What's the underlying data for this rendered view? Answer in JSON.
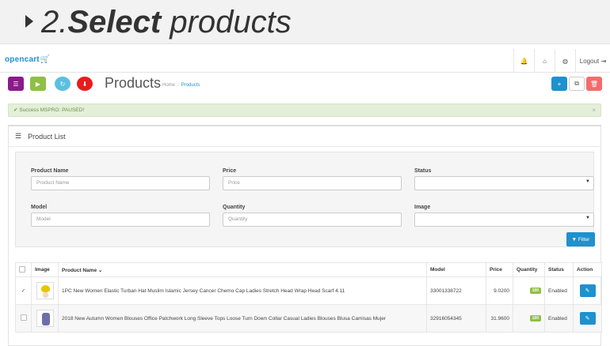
{
  "banner": {
    "step": "2.",
    "word_bold": "Select",
    "word_rest": " products"
  },
  "navbar": {
    "logo": "opencart",
    "icons": [
      "bell-icon",
      "home-icon",
      "globe-icon"
    ],
    "logout_label": "Logout"
  },
  "toolbar": {
    "page_title": "Products",
    "breadcrumb": [
      "Home",
      "Products"
    ],
    "left_buttons": [
      {
        "name": "mspro-menu-button",
        "color": "#8b1a8b"
      },
      {
        "name": "mspro-start-button",
        "color": "#8fbf45"
      },
      {
        "name": "mspro-refresh-button",
        "color": "#5bc0de"
      },
      {
        "name": "mspro-download-button",
        "color": "#e81c1c"
      }
    ],
    "right_buttons": [
      {
        "name": "add-button",
        "color": "#1e91cf"
      },
      {
        "name": "copy-button",
        "color": "#ffffff"
      },
      {
        "name": "delete-button",
        "color": "#f56b6b"
      }
    ]
  },
  "alert": {
    "text": "Success MSPRO: PAUSED!",
    "close": "×"
  },
  "panel": {
    "title": "Product List"
  },
  "filter": {
    "product_name": {
      "label": "Product Name",
      "placeholder": "Product Name"
    },
    "price": {
      "label": "Price",
      "placeholder": "Price"
    },
    "status": {
      "label": "Status",
      "value": ""
    },
    "model": {
      "label": "Model",
      "placeholder": "Model"
    },
    "quantity": {
      "label": "Quantity",
      "placeholder": "Quantity"
    },
    "image": {
      "label": "Image",
      "value": ""
    },
    "button": "Filter"
  },
  "table": {
    "headers": {
      "image": "Image",
      "product_name": "Product Name",
      "model": "Model",
      "price": "Price",
      "quantity": "Quantity",
      "status": "Status",
      "action": "Action"
    },
    "rows": [
      {
        "name": "1PC New Women Elastic Turban Hat Muslim Islamic Jersey Cancer Chemo Cap Ladies Stretch Head Wrap Head Scarf 4.11",
        "model": "33001338722",
        "price": "9.0200",
        "quantity": "100",
        "status": "Enabled"
      },
      {
        "name": "2018 New Autumn Women Blouses Office Patchwork Long Sleeve Tops Loose Turn Down Collar Casual Ladies Blouses Blusa Camisas Mujer",
        "model": "32916054345",
        "price": "31.9600",
        "quantity": "100",
        "status": "Enabled"
      }
    ]
  },
  "colors": {
    "accent": "#1e91cf",
    "success_bg": "#e3efd8",
    "qty_badge": "#8fbf45"
  }
}
